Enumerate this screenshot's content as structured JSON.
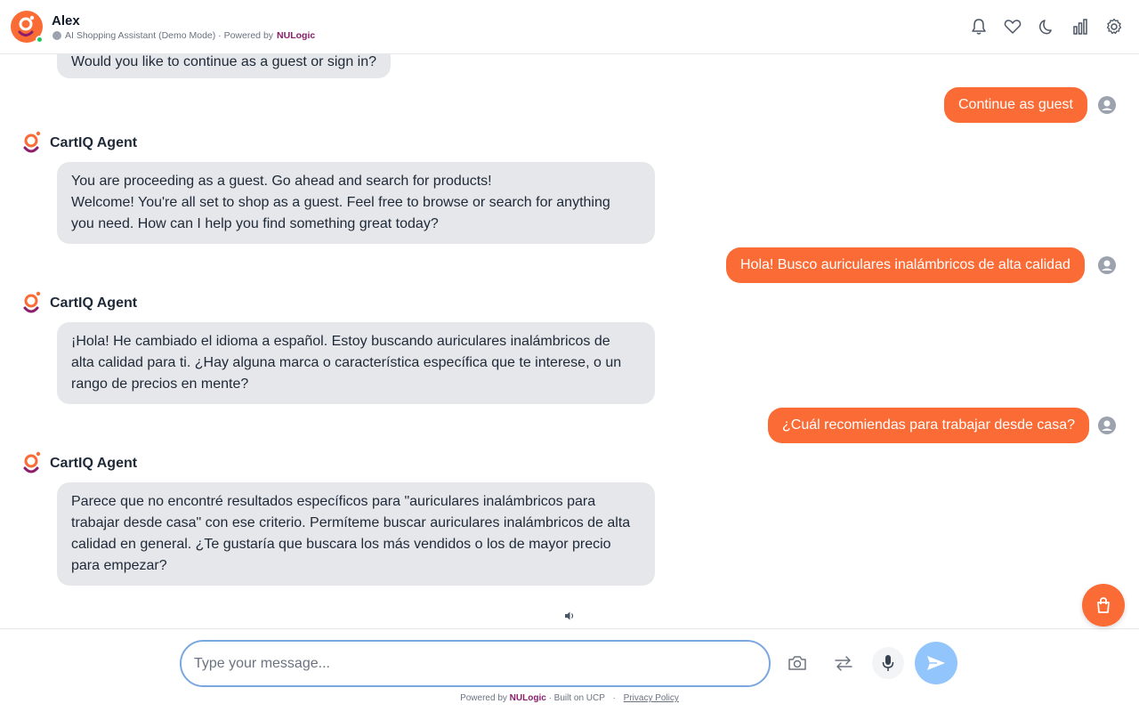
{
  "header": {
    "name": "Alex",
    "subtitle": "AI Shopping Assistant (Demo Mode) · Powered by",
    "brand": "NULogic",
    "icons": [
      "bell-icon",
      "heart-icon",
      "moon-icon",
      "bar-chart-icon",
      "gear-icon"
    ]
  },
  "chat": {
    "agent_name": "CartIQ Agent",
    "msg0": "Would you like to continue as a guest or sign in?",
    "user1": "Continue as guest",
    "agent1": [
      "You are proceeding as a guest. Go ahead and search for products!",
      "Welcome! You're all set to shop as a guest. Feel free to browse or search for anything",
      "you need. How can I help you find something great today?"
    ],
    "user2": "Hola! Busco auriculares inalámbricos de alta calidad",
    "agent2": [
      "¡Hola! He cambiado el idioma a español. Estoy buscando auriculares inalámbricos de",
      "alta calidad para ti. ¿Hay alguna marca o característica específica que te interese, o un",
      "rango de precios en mente?"
    ],
    "user3": "¿Cuál recomiendas para trabajar desde casa?",
    "agent3": [
      "Parece que no encontré resultados específicos para \"auriculares inalámbricos para",
      "trabajar desde casa\" con ese criterio. Permíteme buscar auriculares inalámbricos de alta",
      "calidad en general. ¿Te gustaría que buscara los más vendidos o los de mayor precio",
      "para empezar?"
    ]
  },
  "composer": {
    "placeholder": "Type your message...",
    "footer_powered": "Powered by",
    "footer_brand": "NULogic",
    "footer_built": "· Built on UCP",
    "footer_sep": "·",
    "privacy": "Privacy Policy"
  },
  "colors": {
    "accent": "#fb6b35",
    "agent_bubble": "#e5e7eb",
    "brand": "#8b1d6b",
    "send": "#93c5fd"
  }
}
